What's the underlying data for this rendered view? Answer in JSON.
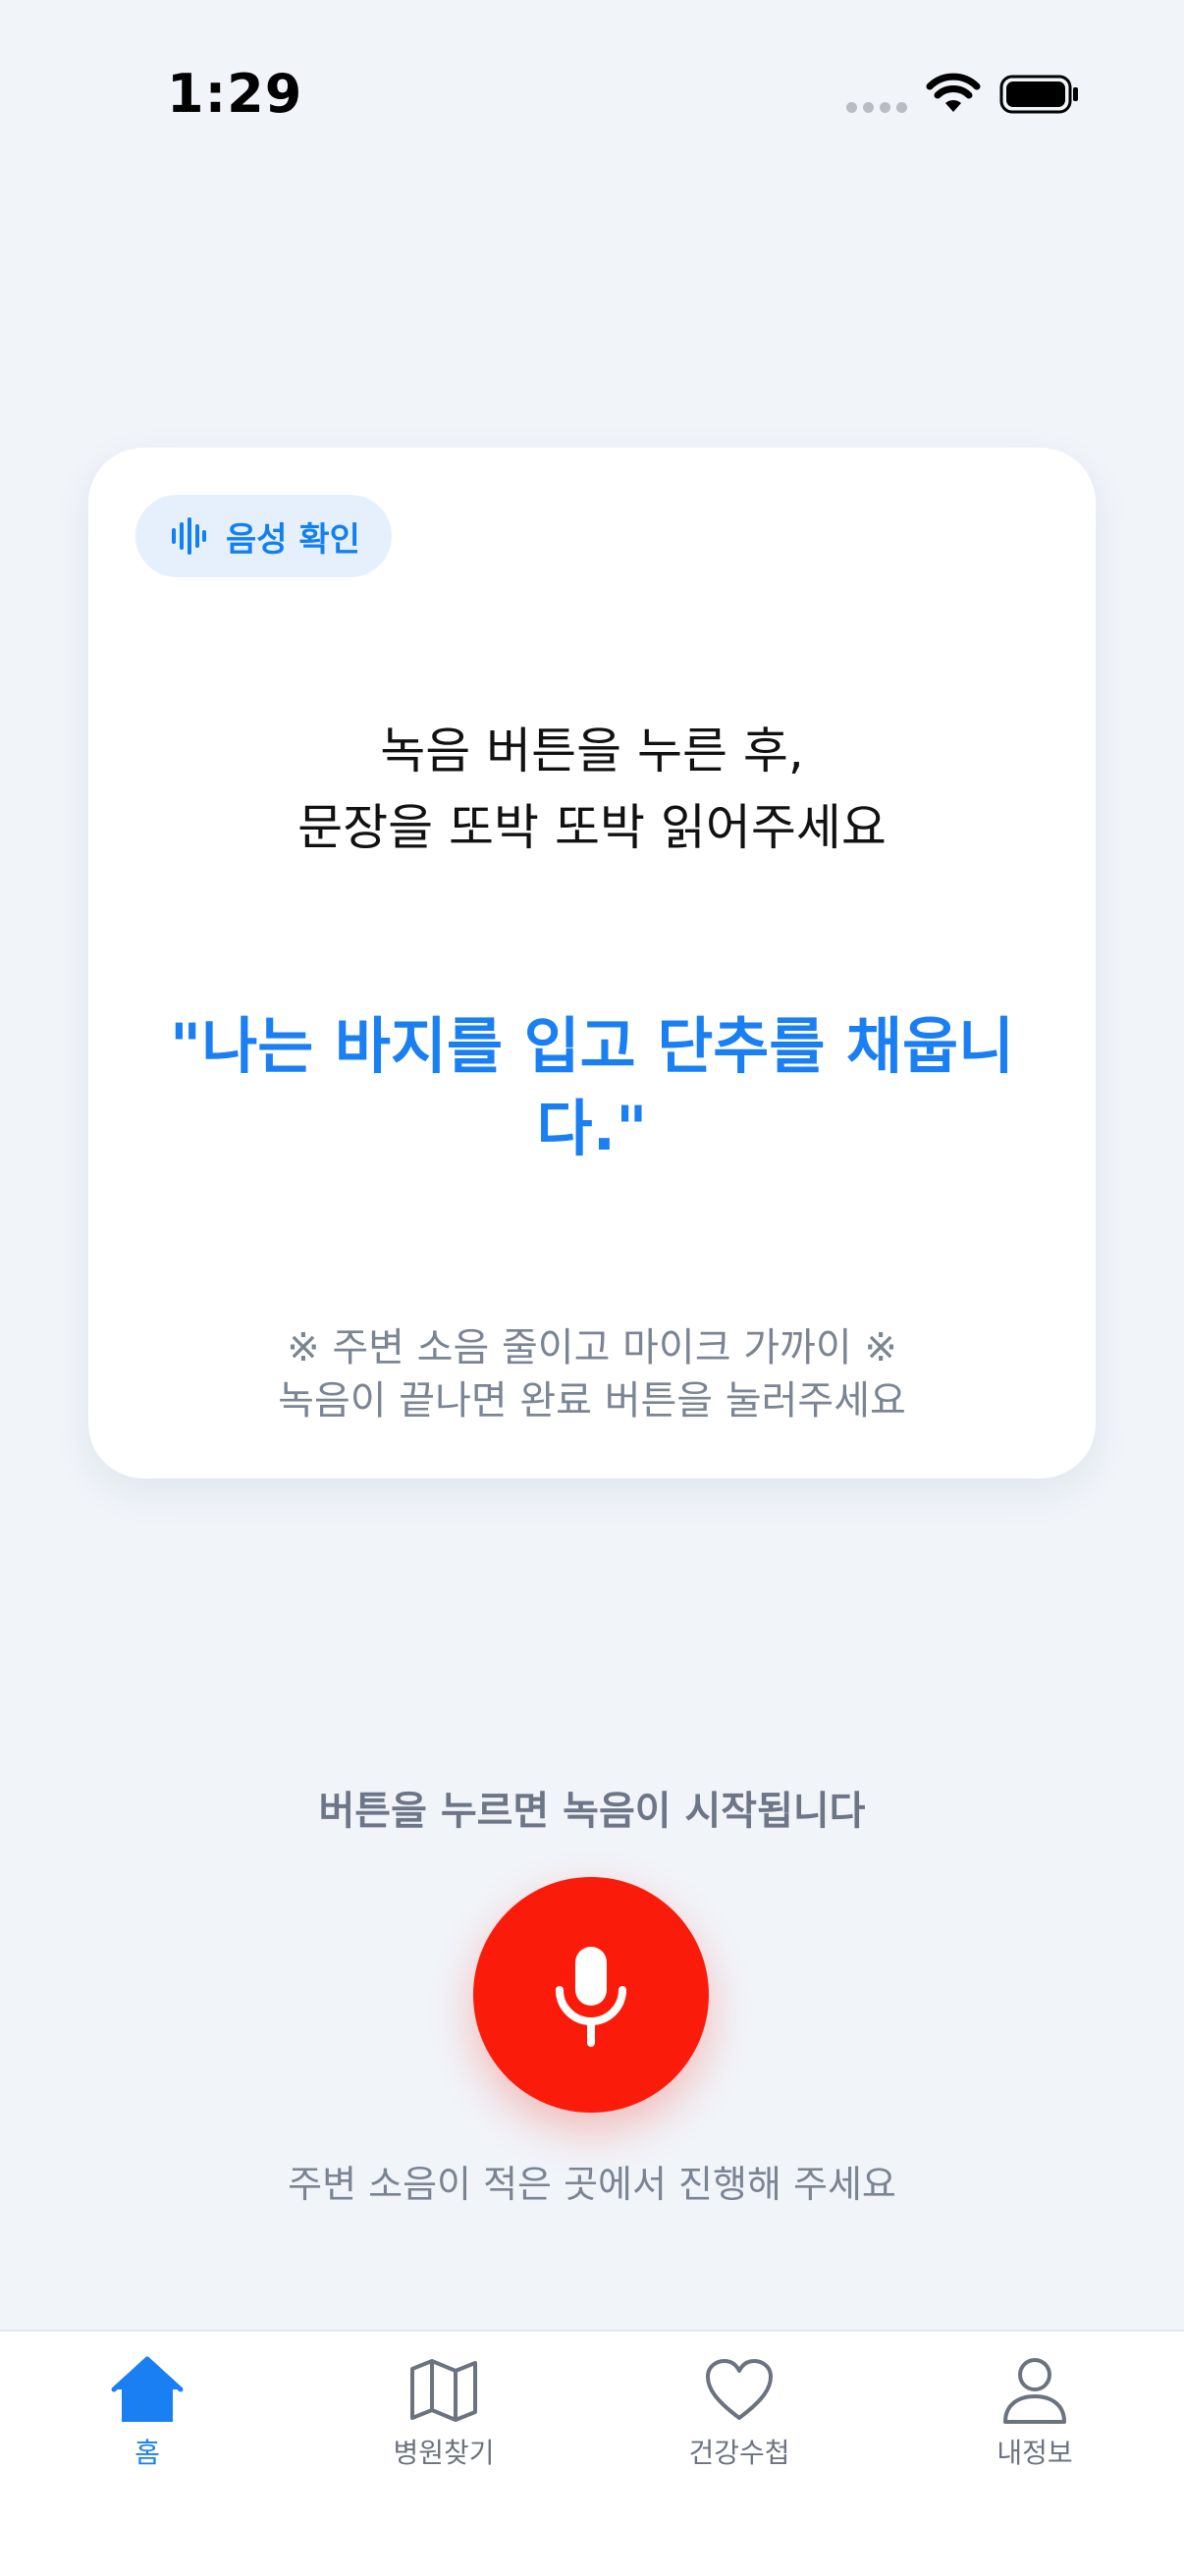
{
  "status_bar": {
    "time": "1:29"
  },
  "card": {
    "badge_label": "음성 확인",
    "instruction_line1": "녹음 버튼을 누른 후,",
    "instruction_line2": "문장을 또박 또박 읽어주세요",
    "sentence": "\"나는 바지를 입고 단추를 채웁니다.\"",
    "note_line1": "※ 주변 소음 줄이고 마이크 가까이 ※",
    "note_line2": "녹음이 끝나면 완료 버튼을 눌러주세요"
  },
  "recorder": {
    "hint": "버튼을 누르면 녹음이 시작됩니다",
    "environment_hint": "주변 소음이 적은 곳에서 진행해 주세요"
  },
  "tab_bar": {
    "tabs": [
      {
        "label": "홈",
        "icon": "home-icon",
        "active": true
      },
      {
        "label": "병원찾기",
        "icon": "map-icon",
        "active": false
      },
      {
        "label": "건강수첩",
        "icon": "heart-icon",
        "active": false
      },
      {
        "label": "내정보",
        "icon": "person-icon",
        "active": false
      }
    ]
  },
  "colors": {
    "accent": "#1a7ff2",
    "record": "#fb1b0a",
    "background": "#f1f4f9"
  }
}
